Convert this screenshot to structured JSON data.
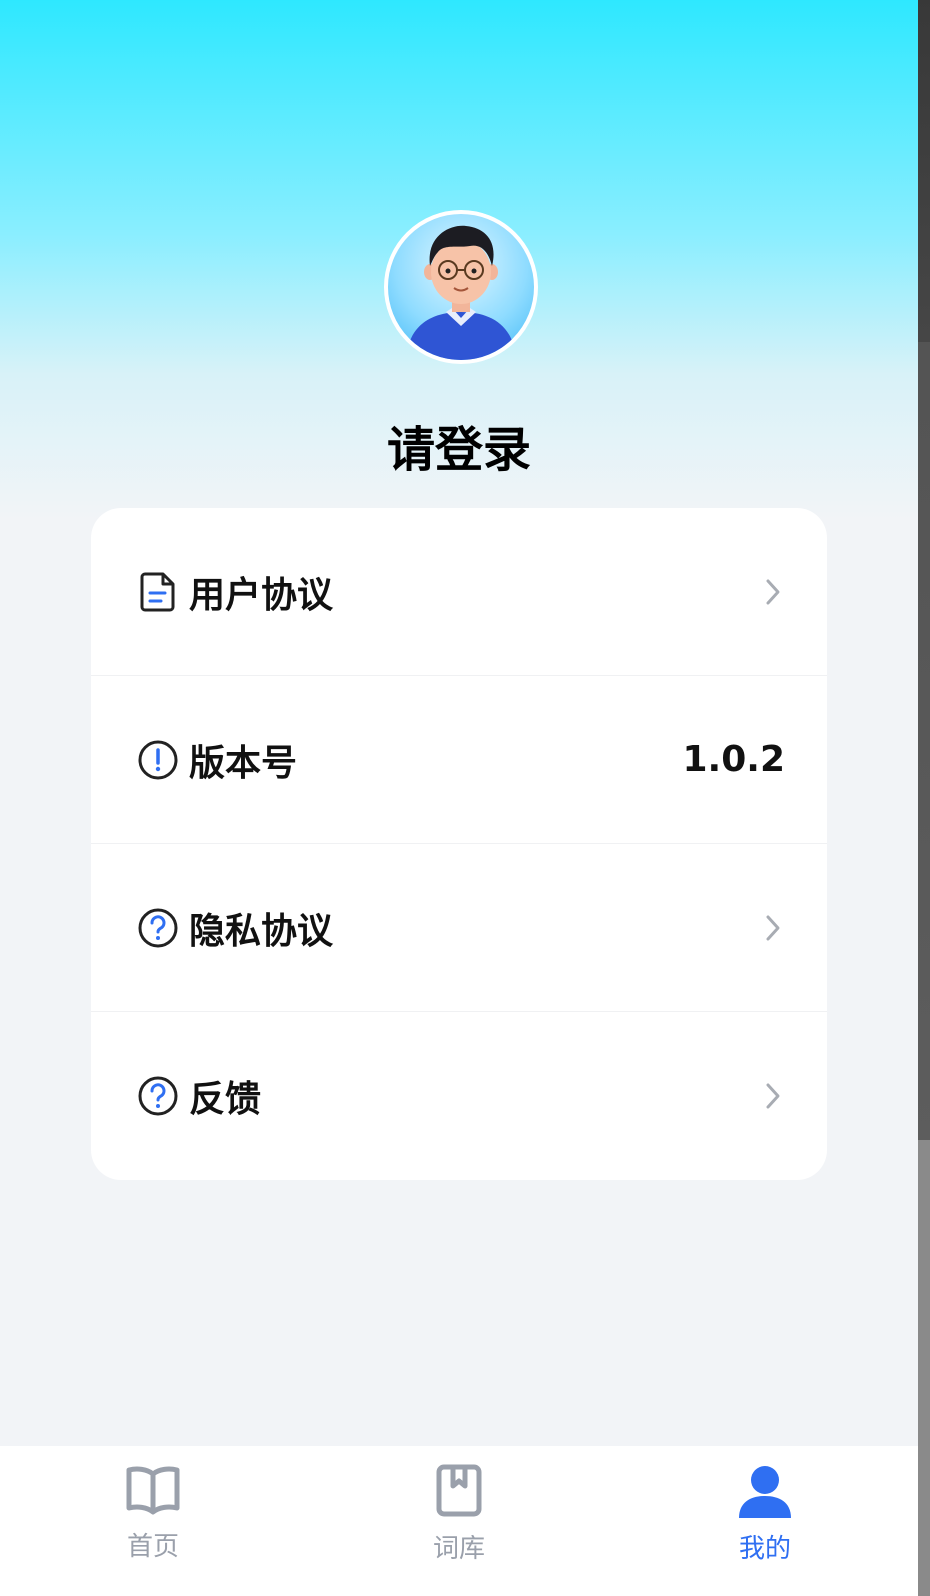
{
  "profile": {
    "login_prompt": "请登录"
  },
  "menu": {
    "items": [
      {
        "label": "用户协议",
        "icon": "document-icon",
        "trailing": "chevron"
      },
      {
        "label": "版本号",
        "icon": "info-icon",
        "value": "1.0.2"
      },
      {
        "label": "隐私协议",
        "icon": "question-icon",
        "trailing": "chevron"
      },
      {
        "label": "反馈",
        "icon": "question-icon",
        "trailing": "chevron"
      }
    ]
  },
  "tabbar": {
    "tabs": [
      {
        "label": "首页",
        "icon": "book-open-icon",
        "active": false
      },
      {
        "label": "词库",
        "icon": "bookmark-book-icon",
        "active": false
      },
      {
        "label": "我的",
        "icon": "person-icon",
        "active": true
      }
    ]
  },
  "colors": {
    "accent": "#2f6ff2",
    "header_top": "#2ee8ff",
    "background": "#f2f4f7"
  }
}
